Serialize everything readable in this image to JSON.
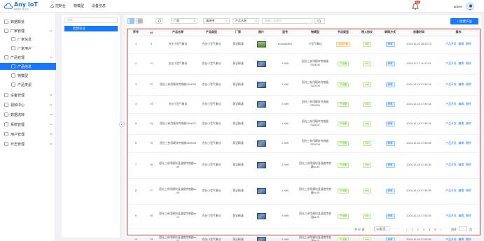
{
  "app": {
    "logo_title": "Any IoT",
    "logo_sub": "物联网开放平台"
  },
  "topnav": [
    {
      "label": "控制台",
      "icon": "home-icon"
    },
    {
      "label": "物模型",
      "icon": ""
    },
    {
      "label": "设备信息",
      "icon": ""
    }
  ],
  "header": {
    "notification_count": "99+",
    "username": "admin"
  },
  "sidebar": {
    "items": [
      {
        "label": "数据概览",
        "icon": "grid-icon",
        "level": 0,
        "expandable": false,
        "active": false
      },
      {
        "label": "厂家管理",
        "icon": "shop-icon",
        "level": 0,
        "expandable": true,
        "active": false
      },
      {
        "label": "厂家信息",
        "icon": "gear-icon",
        "level": 1,
        "expandable": false,
        "active": false
      },
      {
        "label": "厂家用户",
        "icon": "user-icon",
        "level": 1,
        "expandable": false,
        "active": false
      },
      {
        "label": "产品管理",
        "icon": "send-icon",
        "level": 0,
        "expandable": true,
        "active": false
      },
      {
        "label": "产品信息",
        "icon": "triangle-icon",
        "level": 1,
        "expandable": false,
        "active": true
      },
      {
        "label": "物模型",
        "icon": "refresh-icon",
        "level": 1,
        "expandable": false,
        "active": false
      },
      {
        "label": "产品类型",
        "icon": "doc-icon",
        "level": 1,
        "expandable": false,
        "active": false
      },
      {
        "label": "设备管理",
        "icon": "link-icon",
        "level": 0,
        "expandable": true,
        "active": false
      },
      {
        "label": "视频中心",
        "icon": "video-icon",
        "level": 0,
        "expandable": true,
        "active": false
      },
      {
        "label": "数据流转",
        "icon": "flow-icon",
        "level": 0,
        "expandable": true,
        "active": false
      },
      {
        "label": "系统管理",
        "icon": "settings-icon",
        "level": 0,
        "expandable": true,
        "active": false
      },
      {
        "label": "用户管理",
        "icon": "person-icon",
        "level": 0,
        "expandable": true,
        "active": false
      },
      {
        "label": "日志管理",
        "icon": "log-icon",
        "level": 0,
        "expandable": true,
        "active": false
      }
    ]
  },
  "category": {
    "search_placeholder": "搜索",
    "selected_node": "智慧农业"
  },
  "toolbar": {
    "vendor_select": "厂家",
    "status_select": "请选择",
    "field_select": "产品名称",
    "search_placeholder": "请输入关键词",
    "create_label": "+ 创建产品"
  },
  "table": {
    "columns": [
      "序号",
      "id",
      "产品名称",
      "产品类型",
      "厂家",
      "图片",
      "型号",
      "物模型",
      "节点类型",
      "接入协议",
      "联网方式",
      "创建时间",
      "操作"
    ],
    "rows": [
      {
        "no": "1",
        "id": "9",
        "name": "农业小型气象站",
        "type": "农业小型气象站",
        "vendor": "赛迈精通",
        "img": "green",
        "model": "ecccqq0801",
        "thing": "小型气象站",
        "node": "直连设备",
        "node_kind": "direct",
        "protocol": "http",
        "net": "蜂窝",
        "created": "2024-12-02 16:23:13"
      },
      {
        "no": "2",
        "id": "71",
        "name": "农业小型气象站",
        "type": "农业小型气象站",
        "vendor": "赛迈精通",
        "img": "blue",
        "model": "X-NW",
        "thing": "国光三参用模块传感器SD0004",
        "node": "子设备",
        "node_kind": "child",
        "protocol": "http",
        "net": "蜂窝",
        "created": "2024-12-17 11:47:01"
      },
      {
        "no": "3",
        "id": "72",
        "name": "国光三参用模块传感器SD0005",
        "type": "农业小型气象站",
        "vendor": "赛迈精通",
        "img": "blue",
        "model": "X-NW",
        "thing": "国光三参用模块传感器SD0005",
        "node": "子设备",
        "node_kind": "child",
        "protocol": "http",
        "net": "蜂窝",
        "created": "2024-12-18 17:39:34"
      },
      {
        "no": "4",
        "id": "73",
        "name": "农业小型气象站",
        "type": "农业小型气象站",
        "vendor": "赛迈精通",
        "img": "blue",
        "model": "X-NW",
        "thing": "国光三参用模块传感器SD0006",
        "node": "子设备",
        "node_kind": "child",
        "protocol": "http",
        "net": "蜂窝",
        "created": "2024-12-18 17:39:34"
      },
      {
        "no": "5",
        "id": "74",
        "name": "国光三参用模块传感器SD0007",
        "type": "农业小型气象站",
        "vendor": "赛迈精通",
        "img": "blue",
        "model": "X-NW",
        "thing": "国光三参用模块传感器SD0007",
        "node": "子设备",
        "node_kind": "child",
        "protocol": "http",
        "net": "蜂窝",
        "created": "2024-12-18 17:39:34"
      },
      {
        "no": "6",
        "id": "75",
        "name": "国光三参用模块传感器SD0008",
        "type": "农业小型气象站",
        "vendor": "赛迈精通",
        "img": "blue",
        "model": "X-NW",
        "thing": "国光三参用模块传感器SD0008",
        "node": "子设备",
        "node_kind": "child",
        "protocol": "http",
        "net": "蜂窝",
        "created": "2024-12-18 17:39:35"
      },
      {
        "no": "7",
        "id": "76",
        "name": "国光三参用模块温湿度传感器ta-d5",
        "type": "农业小型气象站",
        "vendor": "赛迈精通",
        "img": "blue",
        "model": "X-NW",
        "thing": "国光三参用模块温湿度传感器ta-d5",
        "node": "子设备",
        "node_kind": "child",
        "protocol": "http",
        "net": "蜂窝",
        "created": "2024-12-18 17:39:35"
      },
      {
        "no": "8",
        "id": "77",
        "name": "国光三参用模块温湿度传感器ta-d5",
        "type": "农业小型气象站",
        "vendor": "赛迈精通",
        "img": "blue",
        "model": "X-NW",
        "thing": "国光三参用模块温湿度传感器ta-d5",
        "node": "子设备",
        "node_kind": "child",
        "protocol": "http",
        "net": "蜂窝",
        "created": "2024-12-18 17:39:35"
      },
      {
        "no": "9",
        "id": "78",
        "name": "国光三参用模块温湿度传感器ta-f3",
        "type": "农业小型气象站",
        "vendor": "赛迈精通",
        "img": "blue",
        "model": "X-NW",
        "thing": "国光三参用模块温湿度传感器ta-f3",
        "node": "子设备",
        "node_kind": "child",
        "protocol": "http",
        "net": "蜂窝",
        "created": "2024-12-18 17:39:35"
      },
      {
        "no": "10",
        "id": "79",
        "name": "国光三参用模块温湿度传感器ta-f5",
        "type": "农业小型气象站",
        "vendor": "赛迈精通",
        "img": "blue",
        "model": "X-NW",
        "thing": "国光三参用模块温湿度传感器ta-f5",
        "node": "子设备",
        "node_kind": "child",
        "protocol": "http",
        "net": "蜂窝",
        "created": "2024-12-18 17:39:35"
      }
    ],
    "ops": {
      "dev": "产品开发",
      "edit": "编辑",
      "del": "删除"
    }
  },
  "pager": {
    "total": "共 50 条",
    "page_size": "10条/页",
    "pages": [
      "‹",
      "1",
      "2",
      "3",
      "4",
      "5",
      "›"
    ],
    "current": "1",
    "goto_label": "前往",
    "page_unit": "页"
  },
  "colors": {
    "accent": "#1677ff",
    "highlight_border": "#e0392f"
  }
}
